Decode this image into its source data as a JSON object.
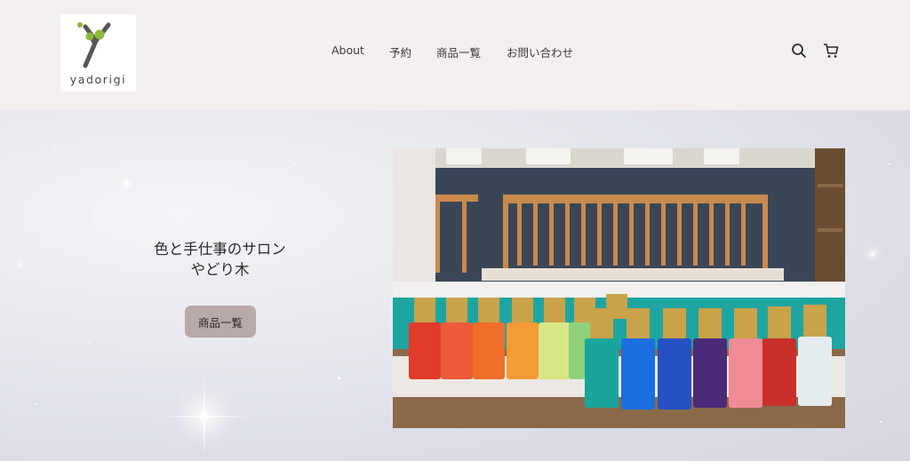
{
  "header": {
    "logo_text": "yadorigi",
    "nav": [
      {
        "label": "About"
      },
      {
        "label": "予約"
      },
      {
        "label": "商品一覧"
      },
      {
        "label": "お問い合わせ"
      }
    ],
    "icons": [
      "search-icon",
      "cart-icon"
    ]
  },
  "hero": {
    "title_line1": "色と手仕事のサロン",
    "title_line2": "やどり木",
    "button_label": "商品一覧"
  },
  "colors": {
    "header_bg": "#f4efef",
    "button_bg": "#b9a9a8",
    "logo_green": "#8bbb3a",
    "logo_branch": "#5a5456"
  }
}
